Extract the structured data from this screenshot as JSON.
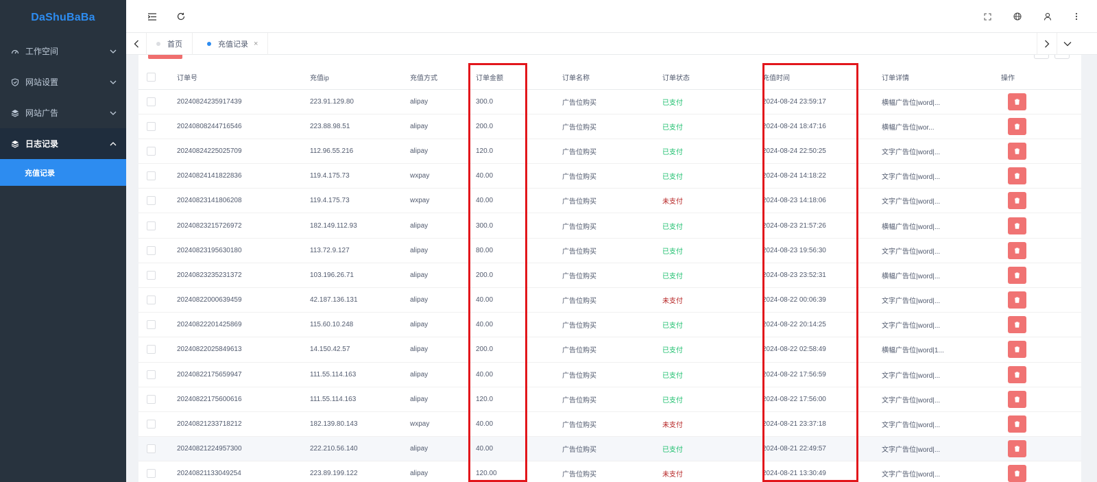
{
  "app": {
    "logo": "DaShuBaBa"
  },
  "sidebar": {
    "items": [
      {
        "label": "工作空间",
        "icon": "dashboard-icon"
      },
      {
        "label": "网站设置",
        "icon": "shield-icon"
      },
      {
        "label": "网站广告",
        "icon": "layers-icon"
      },
      {
        "label": "日志记录",
        "icon": "layers-icon",
        "expanded": true
      }
    ],
    "subitems": [
      {
        "label": "充值记录",
        "active": true
      }
    ]
  },
  "tabs": [
    {
      "label": "首页",
      "active": false
    },
    {
      "label": "充值记录",
      "active": true,
      "close": "×"
    }
  ],
  "table": {
    "columns": [
      "订单号",
      "充值ip",
      "充值方式",
      "订单金额",
      "订单名称",
      "订单状态",
      "充值时间",
      "订单详情",
      "操作"
    ],
    "rows": [
      [
        "20240824235917439",
        "223.91.129.80",
        "alipay",
        "300.0",
        "广告位购买",
        "已支付",
        "2024-08-24 23:59:17",
        "横幅广告位|word|..."
      ],
      [
        "20240808244716546",
        "223.88.98.51",
        "alipay",
        "200.0",
        "广告位购买",
        "已支付",
        "2024-08-24 18:47:16",
        "横幅广告位|wor..."
      ],
      [
        "20240824225025709",
        "112.96.55.216",
        "alipay",
        "120.0",
        "广告位购买",
        "已支付",
        "2024-08-24 22:50:25",
        "文字广告位|word|..."
      ],
      [
        "20240824141822836",
        "119.4.175.73",
        "wxpay",
        "40.00",
        "广告位购买",
        "已支付",
        "2024-08-24 14:18:22",
        "文字广告位|word|..."
      ],
      [
        "20240823141806208",
        "119.4.175.73",
        "wxpay",
        "40.00",
        "广告位购买",
        "未支付",
        "2024-08-23 14:18:06",
        "文字广告位|word|..."
      ],
      [
        "20240823215726972",
        "182.149.112.93",
        "alipay",
        "300.0",
        "广告位购买",
        "已支付",
        "2024-08-23 21:57:26",
        "横幅广告位|word|..."
      ],
      [
        "20240823195630180",
        "113.72.9.127",
        "alipay",
        "80.00",
        "广告位购买",
        "已支付",
        "2024-08-23 19:56:30",
        "文字广告位|word|..."
      ],
      [
        "20240823235231372",
        "103.196.26.71",
        "alipay",
        "200.0",
        "广告位购买",
        "已支付",
        "2024-08-23 23:52:31",
        "横幅广告位|word|..."
      ],
      [
        "20240822000639459",
        "42.187.136.131",
        "alipay",
        "40.00",
        "广告位购买",
        "未支付",
        "2024-08-22 00:06:39",
        "文字广告位|word|..."
      ],
      [
        "20240822201425869",
        "115.60.10.248",
        "alipay",
        "40.00",
        "广告位购买",
        "已支付",
        "2024-08-22 20:14:25",
        "文字广告位|word|..."
      ],
      [
        "20240822025849613",
        "14.150.42.57",
        "alipay",
        "200.0",
        "广告位购买",
        "已支付",
        "2024-08-22 02:58:49",
        "横幅广告位|word|1..."
      ],
      [
        "20240822175659947",
        "111.55.114.163",
        "alipay",
        "40.00",
        "广告位购买",
        "已支付",
        "2024-08-22 17:56:59",
        "文字广告位|word|..."
      ],
      [
        "20240822175600616",
        "111.55.114.163",
        "alipay",
        "120.0",
        "广告位购买",
        "已支付",
        "2024-08-22 17:56:00",
        "文字广告位|word|..."
      ],
      [
        "20240821233718212",
        "182.139.80.143",
        "wxpay",
        "40.00",
        "广告位购买",
        "未支付",
        "2024-08-21 23:37:18",
        "文字广告位|word|..."
      ],
      [
        "20240821224957300",
        "222.210.56.140",
        "alipay",
        "40.00",
        "广告位购买",
        "已支付",
        "2024-08-21 22:49:57",
        "文字广告位|word|..."
      ],
      [
        "20240821133049254",
        "223.89.199.122",
        "alipay",
        "120.00",
        "广告位购买",
        "未支付",
        "2024-08-21 13:30:49",
        "文字广告位|word|..."
      ]
    ],
    "highlighted_row_index": 14
  },
  "colors": {
    "primary": "#2d8cf0",
    "sidebar_bg": "#28333e",
    "paid": "#19be6b",
    "unpaid": "#b41f1f",
    "delete": "#f07373",
    "annotation": "#e2161b"
  }
}
